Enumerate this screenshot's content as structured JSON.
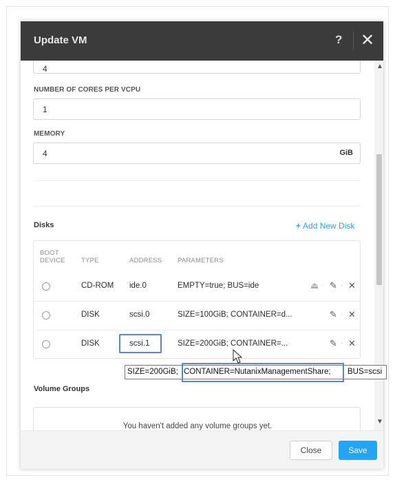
{
  "modal": {
    "title": "Update VM",
    "help_icon": "?",
    "close_icon": "✕"
  },
  "fields": {
    "vcpus_value": "4",
    "cores_label": "NUMBER OF CORES PER VCPU",
    "cores_value": "1",
    "memory_label": "MEMORY",
    "memory_value": "4",
    "memory_unit": "GiB"
  },
  "disks": {
    "title": "Disks",
    "add_label": "Add New Disk",
    "add_icon": "+",
    "headers": {
      "boot_line1": "BOOT",
      "boot_line2": "DEVICE",
      "type": "TYPE",
      "address": "ADDRESS",
      "parameters": "PARAMETERS"
    },
    "rows": [
      {
        "type": "CD-ROM",
        "address": "ide.0",
        "parameters": "EMPTY=true; BUS=ide"
      },
      {
        "type": "DISK",
        "address": "scsi.0",
        "parameters": "SIZE=100GiB; CONTAINER=d..."
      },
      {
        "type": "DISK",
        "address": "scsi.1",
        "parameters": "SIZE=200GiB; CONTAINER=..."
      }
    ]
  },
  "tooltip": {
    "part1": "SIZE=200GiB;",
    "part2": "CONTAINER=NutanixManagementShare;",
    "part3": "BUS=scsi"
  },
  "volume_groups": {
    "title": "Volume Groups",
    "empty_text": "You haven't added any volume groups yet."
  },
  "footer": {
    "close_label": "Close",
    "save_label": "Save"
  },
  "colors": {
    "accent": "#22a5f7",
    "header_bg": "#3b3b3b",
    "highlight": "#5b86c2"
  },
  "icons": [
    "help-icon",
    "close-icon",
    "eject-icon",
    "edit-icon",
    "delete-icon",
    "scroll-up-icon",
    "scroll-down-icon",
    "radio-icon",
    "cursor-icon"
  ]
}
